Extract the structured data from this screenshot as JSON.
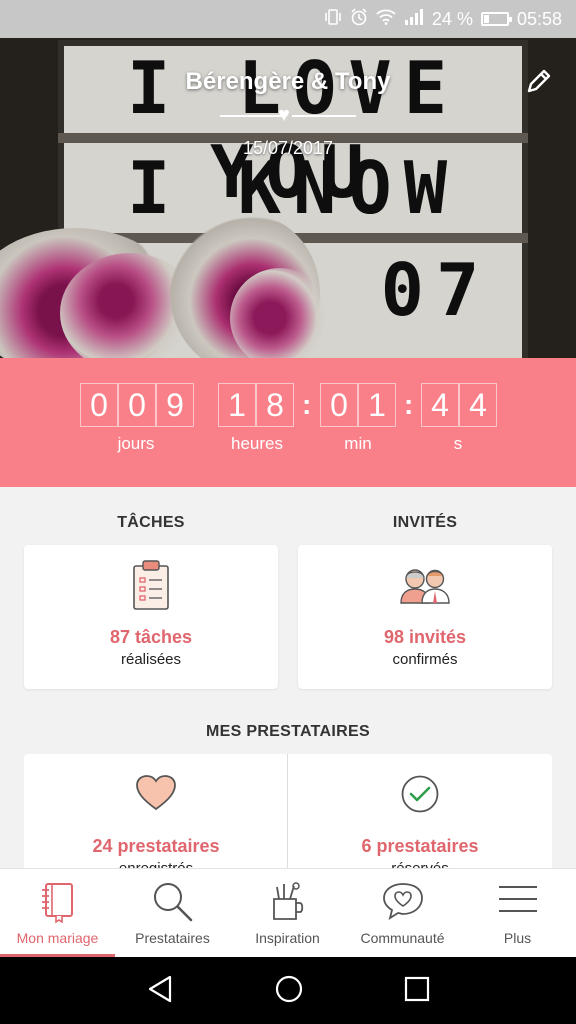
{
  "status_bar": {
    "battery_text": "24 %",
    "battery_level": 0.24,
    "time": "05:58",
    "icons": [
      "vibrate-icon",
      "alarm-icon",
      "wifi-icon",
      "signal-icon",
      "battery-icon"
    ]
  },
  "hero": {
    "couple_names": "Bérengère & Tony",
    "wedding_date": "15/07/2017",
    "lightbox_lines": [
      "I LOVE YOU",
      "I KNOW",
      "15 07"
    ],
    "edit_icon": "pencil-icon"
  },
  "countdown": {
    "days_digits": [
      "0",
      "0",
      "9"
    ],
    "hours_digits": [
      "1",
      "8"
    ],
    "minutes_digits": [
      "0",
      "1"
    ],
    "seconds_digits": [
      "4",
      "4"
    ],
    "labels": {
      "days": "jours",
      "hours": "heures",
      "minutes": "min",
      "seconds": "s"
    },
    "color": "#f98089"
  },
  "tasks": {
    "title": "TÂCHES",
    "count": "87 tâches",
    "sub": "réalisées",
    "icon": "clipboard-icon"
  },
  "guests": {
    "title": "INVITÉS",
    "count": "98 invités",
    "sub": "confirmés",
    "icon": "guests-icon"
  },
  "vendors": {
    "title": "MES PRESTATAIRES",
    "items": [
      {
        "count": "24 prestataires",
        "sub": "enregistrés",
        "icon": "heart-icon"
      },
      {
        "count": "6 prestataires",
        "sub": "réservés",
        "icon": "check-circle-icon"
      }
    ]
  },
  "bottom_nav": {
    "items": [
      {
        "label": "Mon mariage",
        "icon": "notebook-icon",
        "active": true
      },
      {
        "label": "Prestataires",
        "icon": "search-icon",
        "active": false
      },
      {
        "label": "Inspiration",
        "icon": "inspiration-cup-icon",
        "active": false
      },
      {
        "label": "Communauté",
        "icon": "chat-heart-icon",
        "active": false
      },
      {
        "label": "Plus",
        "icon": "menu-icon",
        "active": false
      }
    ],
    "accent": "#e0666e"
  },
  "system_nav": {
    "icons": [
      "back-icon",
      "home-icon",
      "recents-icon"
    ]
  }
}
